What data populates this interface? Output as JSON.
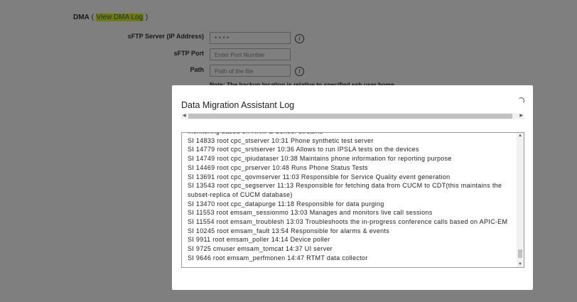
{
  "form": {
    "dma_title": "DMA",
    "view_log_link": "View DMA Log",
    "sftp_server_label": "sFTP Server (IP Address)",
    "sftp_server_value": "* * * *",
    "sftp_port_label": "sFTP Port",
    "sftp_port_placeholder": "Enter Port Number",
    "path_label": "Path",
    "path_placeholder": "Path of the file",
    "note": "Note: The backup location is relative to specified ssh user home"
  },
  "modal": {
    "title": "Data Migration Assistant Log",
    "log_lines": [
      "monitoring based on RRM & Sensor streams",
      "SI 14833 root cpc_stserver 10:31 Phone synthetic test server",
      "SI 14779 root cpc_srstserver 10:36 Allows to run IPSLA tests on the devices",
      "SI 14749 root cpc_ipiudataser 10:38 Maintains phone information for reporting purpose",
      "SI 14469 root cpc_prserver 10:48 Runs Phone Status Tests",
      "SI 13691 root cpc_qovmserver 11:03 Responsible for Service Quality event generation",
      "SI 13543 root cpc_segserver 11:13 Responsible for fetching data from CUCM to CDT(this maintains the subset-replica of CUCM database)",
      "SI 13470 root cpc_datapurge 11:18 Responsible for data purging",
      "SI 11553 root emsam_sessionmo 13:03 Manages and monitors live call sessions",
      "SI 11554 root emsam_troublesh 13:03 Troubleshoots the in-progress conference calls based on APIC-EM",
      "SI 10245 root emsam_fault 13:54 Responsible for alarms & events",
      "SI 9911 root emsam_poller 14:14 Device poller",
      "SI 9725 cmuser emsam_tomcat 14:37 UI server",
      "SI 9646 root emsam_perfmonen 14:47 RTMT data collector"
    ]
  }
}
